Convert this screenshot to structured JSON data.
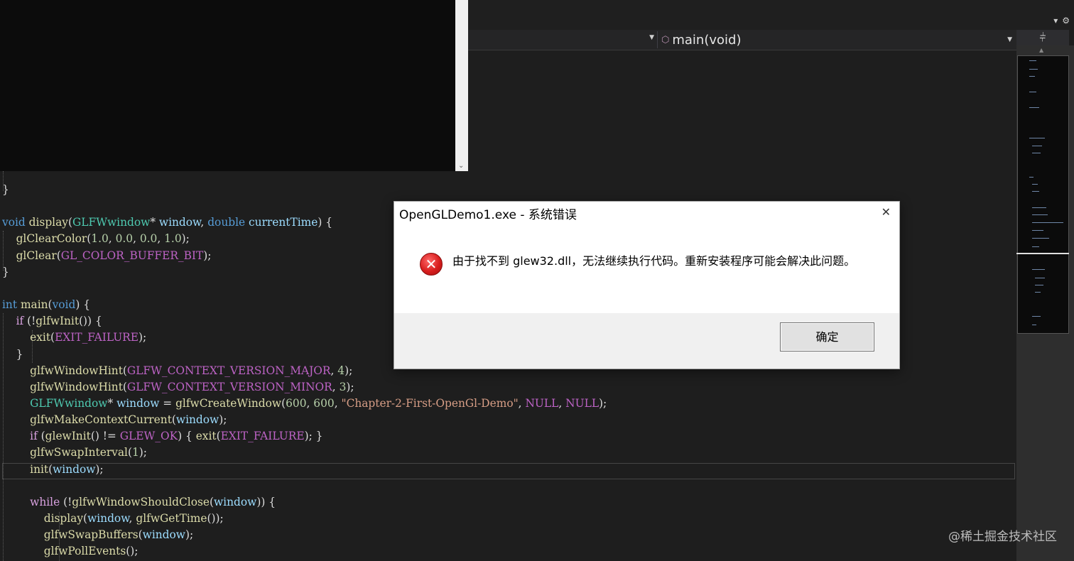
{
  "window": {
    "top_icons": [
      "▾",
      "⚙"
    ],
    "navigation": {
      "function_dropdown_value": "main(void)",
      "split_icon": "⫩"
    }
  },
  "editor": {
    "lines": [
      {
        "tokens": [
          {
            "t": "}",
            "c": ""
          }
        ]
      },
      {
        "tokens": []
      },
      {
        "tokens": [
          {
            "t": "void",
            "c": "kw"
          },
          {
            "t": " ",
            "c": ""
          },
          {
            "t": "display",
            "c": "fn"
          },
          {
            "t": "(",
            "c": ""
          },
          {
            "t": "GLFWwindow",
            "c": "ty"
          },
          {
            "t": "* ",
            "c": ""
          },
          {
            "t": "window",
            "c": "var"
          },
          {
            "t": ", ",
            "c": ""
          },
          {
            "t": "double",
            "c": "kw"
          },
          {
            "t": " ",
            "c": ""
          },
          {
            "t": "currentTime",
            "c": "var"
          },
          {
            "t": ") {",
            "c": ""
          }
        ]
      },
      {
        "tokens": [
          {
            "t": "    ",
            "c": ""
          },
          {
            "t": "glClearColor",
            "c": "fn"
          },
          {
            "t": "(",
            "c": ""
          },
          {
            "t": "1.0",
            "c": "num"
          },
          {
            "t": ", ",
            "c": ""
          },
          {
            "t": "0.0",
            "c": "num"
          },
          {
            "t": ", ",
            "c": ""
          },
          {
            "t": "0.0",
            "c": "num"
          },
          {
            "t": ", ",
            "c": ""
          },
          {
            "t": "1.0",
            "c": "num"
          },
          {
            "t": ");",
            "c": ""
          }
        ]
      },
      {
        "tokens": [
          {
            "t": "    ",
            "c": ""
          },
          {
            "t": "glClear",
            "c": "fn"
          },
          {
            "t": "(",
            "c": ""
          },
          {
            "t": "GL_COLOR_BUFFER_BIT",
            "c": "mac"
          },
          {
            "t": ");",
            "c": ""
          }
        ]
      },
      {
        "tokens": [
          {
            "t": "}",
            "c": ""
          }
        ]
      },
      {
        "tokens": []
      },
      {
        "tokens": [
          {
            "t": "int",
            "c": "kw"
          },
          {
            "t": " ",
            "c": ""
          },
          {
            "t": "main",
            "c": "fn"
          },
          {
            "t": "(",
            "c": ""
          },
          {
            "t": "void",
            "c": "kw"
          },
          {
            "t": ") {",
            "c": ""
          }
        ]
      },
      {
        "tokens": [
          {
            "t": "    ",
            "c": ""
          },
          {
            "t": "if",
            "c": "kw2"
          },
          {
            "t": " (!",
            "c": ""
          },
          {
            "t": "glfwInit",
            "c": "fn"
          },
          {
            "t": "()) {",
            "c": ""
          }
        ]
      },
      {
        "tokens": [
          {
            "t": "        ",
            "c": ""
          },
          {
            "t": "exit",
            "c": "fn"
          },
          {
            "t": "(",
            "c": ""
          },
          {
            "t": "EXIT_FAILURE",
            "c": "mac"
          },
          {
            "t": ");",
            "c": ""
          }
        ]
      },
      {
        "tokens": [
          {
            "t": "    }",
            "c": ""
          }
        ]
      },
      {
        "tokens": [
          {
            "t": "        ",
            "c": ""
          },
          {
            "t": "glfwWindowHint",
            "c": "fn"
          },
          {
            "t": "(",
            "c": ""
          },
          {
            "t": "GLFW_CONTEXT_VERSION_MAJOR",
            "c": "mac"
          },
          {
            "t": ", ",
            "c": ""
          },
          {
            "t": "4",
            "c": "num"
          },
          {
            "t": ");",
            "c": ""
          }
        ]
      },
      {
        "tokens": [
          {
            "t": "        ",
            "c": ""
          },
          {
            "t": "glfwWindowHint",
            "c": "fn"
          },
          {
            "t": "(",
            "c": ""
          },
          {
            "t": "GLFW_CONTEXT_VERSION_MINOR",
            "c": "mac"
          },
          {
            "t": ", ",
            "c": ""
          },
          {
            "t": "3",
            "c": "num"
          },
          {
            "t": ");",
            "c": ""
          }
        ]
      },
      {
        "tokens": [
          {
            "t": "        ",
            "c": ""
          },
          {
            "t": "GLFWwindow",
            "c": "ty"
          },
          {
            "t": "* ",
            "c": ""
          },
          {
            "t": "window",
            "c": "var"
          },
          {
            "t": " = ",
            "c": ""
          },
          {
            "t": "glfwCreateWindow",
            "c": "fn"
          },
          {
            "t": "(",
            "c": ""
          },
          {
            "t": "600",
            "c": "num"
          },
          {
            "t": ", ",
            "c": ""
          },
          {
            "t": "600",
            "c": "num"
          },
          {
            "t": ", ",
            "c": ""
          },
          {
            "t": "\"Chapter-2-First-OpenGl-Demo\"",
            "c": "str"
          },
          {
            "t": ", ",
            "c": ""
          },
          {
            "t": "NULL",
            "c": "mac"
          },
          {
            "t": ", ",
            "c": ""
          },
          {
            "t": "NULL",
            "c": "mac"
          },
          {
            "t": ");",
            "c": ""
          }
        ]
      },
      {
        "tokens": [
          {
            "t": "        ",
            "c": ""
          },
          {
            "t": "glfwMakeContextCurrent",
            "c": "fn"
          },
          {
            "t": "(",
            "c": ""
          },
          {
            "t": "window",
            "c": "var"
          },
          {
            "t": ");",
            "c": ""
          }
        ]
      },
      {
        "tokens": [
          {
            "t": "        ",
            "c": ""
          },
          {
            "t": "if",
            "c": "kw2"
          },
          {
            "t": " (",
            "c": ""
          },
          {
            "t": "glewInit",
            "c": "fn"
          },
          {
            "t": "() != ",
            "c": ""
          },
          {
            "t": "GLEW_OK",
            "c": "mac"
          },
          {
            "t": ") { ",
            "c": ""
          },
          {
            "t": "exit",
            "c": "fn"
          },
          {
            "t": "(",
            "c": ""
          },
          {
            "t": "EXIT_FAILURE",
            "c": "mac"
          },
          {
            "t": "); }",
            "c": ""
          }
        ]
      },
      {
        "tokens": [
          {
            "t": "        ",
            "c": ""
          },
          {
            "t": "glfwSwapInterval",
            "c": "fn"
          },
          {
            "t": "(",
            "c": ""
          },
          {
            "t": "1",
            "c": "num"
          },
          {
            "t": ");",
            "c": ""
          }
        ]
      },
      {
        "tokens": [
          {
            "t": "        ",
            "c": ""
          },
          {
            "t": "init",
            "c": "fn"
          },
          {
            "t": "(",
            "c": ""
          },
          {
            "t": "window",
            "c": "var"
          },
          {
            "t": ");",
            "c": ""
          }
        ]
      },
      {
        "tokens": []
      },
      {
        "tokens": [
          {
            "t": "        ",
            "c": ""
          },
          {
            "t": "while",
            "c": "kw2"
          },
          {
            "t": " (!",
            "c": ""
          },
          {
            "t": "glfwWindowShouldClose",
            "c": "fn"
          },
          {
            "t": "(",
            "c": ""
          },
          {
            "t": "window",
            "c": "var"
          },
          {
            "t": ")) {",
            "c": ""
          }
        ]
      },
      {
        "tokens": [
          {
            "t": "            ",
            "c": ""
          },
          {
            "t": "display",
            "c": "fn"
          },
          {
            "t": "(",
            "c": ""
          },
          {
            "t": "window",
            "c": "var"
          },
          {
            "t": ", ",
            "c": ""
          },
          {
            "t": "glfwGetTime",
            "c": "fn"
          },
          {
            "t": "());",
            "c": ""
          }
        ]
      },
      {
        "tokens": [
          {
            "t": "            ",
            "c": ""
          },
          {
            "t": "glfwSwapBuffers",
            "c": "fn"
          },
          {
            "t": "(",
            "c": ""
          },
          {
            "t": "window",
            "c": "var"
          },
          {
            "t": ");",
            "c": ""
          }
        ]
      },
      {
        "tokens": [
          {
            "t": "            ",
            "c": ""
          },
          {
            "t": "glfwPollEvents",
            "c": "fn"
          },
          {
            "t": "();",
            "c": ""
          }
        ]
      }
    ]
  },
  "dialog": {
    "title": "OpenGLDemo1.exe - 系统错误",
    "close_icon": "✕",
    "error_icon": "✕",
    "message": "由于找不到 glew32.dll，无法继续执行代码。重新安装程序可能会解决此问题。",
    "ok_label": "确定"
  },
  "watermark": "@稀土掘金技术社区"
}
